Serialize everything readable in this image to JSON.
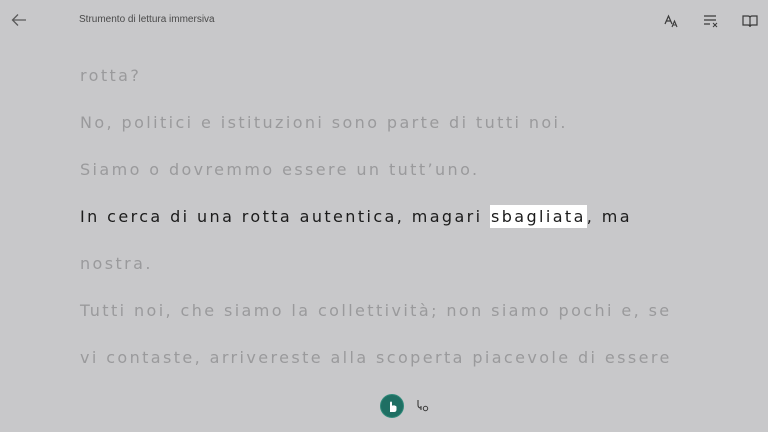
{
  "header": {
    "title": "Strumento di lettura immersiva",
    "back_icon": "back-arrow-icon",
    "tools": [
      "text-preferences-icon",
      "grammar-options-icon",
      "reading-preferences-icon"
    ]
  },
  "reading": {
    "line1": "rotta?",
    "line2": "No, politici e istituzioni sono parte di tutti noi.",
    "line3": "Siamo o dovremmo essere un tutt’uno.",
    "line4_before": "In cerca di una rotta autentica, magari ",
    "line4_highlight": "sbagliata",
    "line4_after": ", ma",
    "line5": "nostra.",
    "line6": "Tutti noi, che siamo la collettività; non siamo pochi e, se",
    "line7": "vi contaste, arrivereste alla scoperta piacevole di essere"
  },
  "controls": {
    "play_icon": "hand-pointer-icon",
    "voice_icon": "voice-settings-icon"
  },
  "colors": {
    "background": "#c8c8ca",
    "dim_text": "#9a9a9c",
    "focus_text": "#1b1b1b",
    "highlight": "#ffffff",
    "accent": "#1f6f63"
  }
}
